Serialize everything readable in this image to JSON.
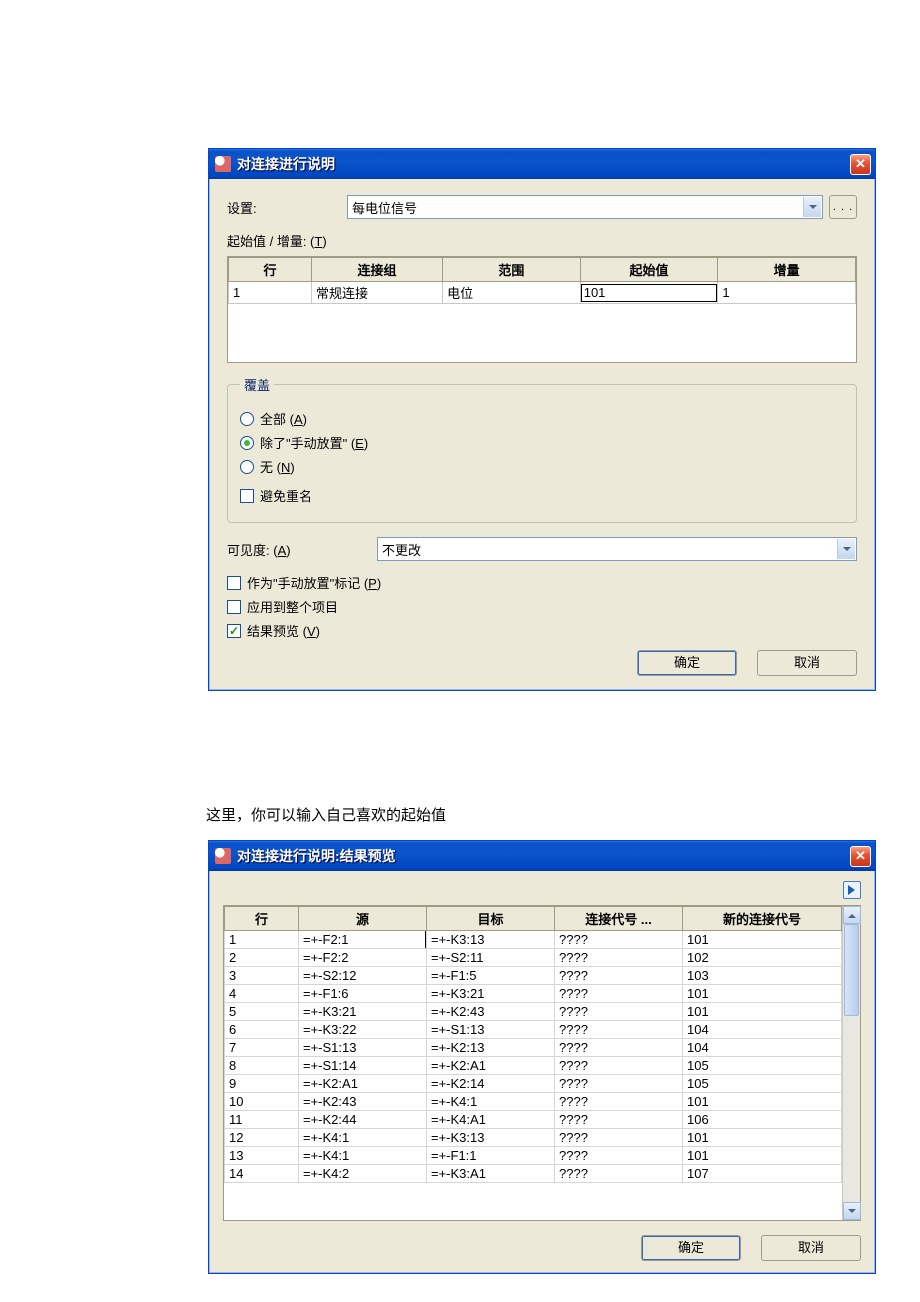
{
  "dialog1": {
    "title": "对连接进行说明",
    "settings_label": "设置:",
    "settings_value": "每电位信号",
    "more_label": ". . .",
    "start_inc_label": "起始值 / 增量:  (",
    "start_inc_hotkey": "T",
    "start_inc_label_end": ")",
    "table": {
      "headers": {
        "row": "行",
        "group": "连接组",
        "range": "范围",
        "start": "起始值",
        "inc": "增量"
      },
      "rows": [
        {
          "row": "1",
          "group": "常规连接",
          "range": "电位",
          "start": "101",
          "inc": "1"
        }
      ]
    },
    "overwrite": {
      "legend": "覆盖",
      "all": "全部 (",
      "all_hk": "A",
      "all_end": ")",
      "except": "除了\"手动放置\"  (",
      "except_hk": "E",
      "except_end": ")",
      "none": "无 (",
      "none_hk": "N",
      "none_end": ")",
      "avoid_dup": "避免重名"
    },
    "visibility_label": "可见度: (",
    "visibility_hk": "A",
    "visibility_label_end": ")",
    "visibility_value": "不更改",
    "mark_manual": "作为\"手动放置\"标记 (",
    "mark_manual_hk": "P",
    "mark_manual_end": ")",
    "apply_whole": "应用到整个项目",
    "preview": "结果预览 (",
    "preview_hk": "V",
    "preview_end": ")",
    "ok": "确定",
    "cancel": "取消"
  },
  "caption": "这里，你可以输入自己喜欢的起始值",
  "dialog2": {
    "title": "对连接进行说明:结果预览",
    "table": {
      "headers": {
        "row": "行",
        "src": "源",
        "dst": "目标",
        "code": "连接代号 ...",
        "newcode": "新的连接代号"
      },
      "rows": [
        {
          "row": "1",
          "src": "=+-F2:1",
          "dst": "=+-K3:13",
          "code": "????",
          "newcode": "101"
        },
        {
          "row": "2",
          "src": "=+-F2:2",
          "dst": "=+-S2:11",
          "code": "????",
          "newcode": "102"
        },
        {
          "row": "3",
          "src": "=+-S2:12",
          "dst": "=+-F1:5",
          "code": "????",
          "newcode": "103"
        },
        {
          "row": "4",
          "src": "=+-F1:6",
          "dst": "=+-K3:21",
          "code": "????",
          "newcode": "101"
        },
        {
          "row": "5",
          "src": "=+-K3:21",
          "dst": "=+-K2:43",
          "code": "????",
          "newcode": "101"
        },
        {
          "row": "6",
          "src": "=+-K3:22",
          "dst": "=+-S1:13",
          "code": "????",
          "newcode": "104"
        },
        {
          "row": "7",
          "src": "=+-S1:13",
          "dst": "=+-K2:13",
          "code": "????",
          "newcode": "104"
        },
        {
          "row": "8",
          "src": "=+-S1:14",
          "dst": "=+-K2:A1",
          "code": "????",
          "newcode": "105"
        },
        {
          "row": "9",
          "src": "=+-K2:A1",
          "dst": "=+-K2:14",
          "code": "????",
          "newcode": "105"
        },
        {
          "row": "10",
          "src": "=+-K2:43",
          "dst": "=+-K4:1",
          "code": "????",
          "newcode": "101"
        },
        {
          "row": "11",
          "src": "=+-K2:44",
          "dst": "=+-K4:A1",
          "code": "????",
          "newcode": "106"
        },
        {
          "row": "12",
          "src": "=+-K4:1",
          "dst": "=+-K3:13",
          "code": "????",
          "newcode": "101"
        },
        {
          "row": "13",
          "src": "=+-K4:1",
          "dst": "=+-F1:1",
          "code": "????",
          "newcode": "101"
        },
        {
          "row": "14",
          "src": "=+-K4:2",
          "dst": "=+-K3:A1",
          "code": "????",
          "newcode": "107"
        }
      ]
    },
    "ok": "确定",
    "cancel": "取消"
  }
}
